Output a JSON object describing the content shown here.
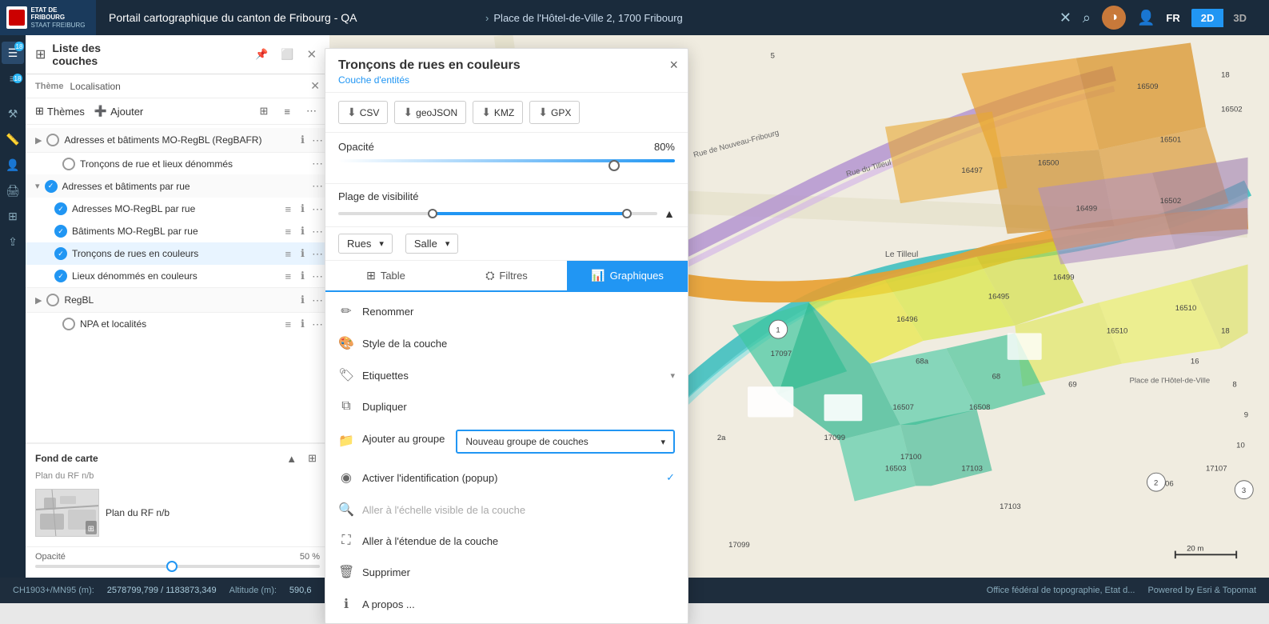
{
  "app": {
    "logo_line1": "ETAT DE FRIBOURG",
    "logo_line2": "STAAT FREIBURG",
    "title": "Portail cartographique du canton de Fribourg - QA",
    "location": "Place de l'Hôtel-de-Ville 2, 1700 Fribourg",
    "lang": "FR"
  },
  "view_toggle": {
    "btn_2d": "2D",
    "btn_3d": "3D"
  },
  "layer_panel": {
    "title": "Liste des couches",
    "theme_label": "Thème",
    "theme_name": "Localisation",
    "themes_btn": "Thèmes",
    "add_btn": "Ajouter",
    "layers": [
      {
        "name": "Adresses et bâtiments MO-RegBL (RegBAFR)",
        "type": "group",
        "indent": 0
      },
      {
        "name": "Tronçons de rue et lieux dénommés",
        "type": "layer",
        "indent": 0
      },
      {
        "name": "Adresses et bâtiments par rue",
        "type": "group_open",
        "indent": 0
      },
      {
        "name": "Adresses MO-RegBL par rue",
        "type": "layer",
        "indent": 1
      },
      {
        "name": "Bâtiments MO-RegBL par rue",
        "type": "layer",
        "indent": 1
      },
      {
        "name": "Tronçons de rues en couleurs",
        "type": "layer",
        "indent": 1
      },
      {
        "name": "Lieux dénommés en couleurs",
        "type": "layer",
        "indent": 1
      },
      {
        "name": "RegBL",
        "type": "group",
        "indent": 0
      },
      {
        "name": "NPA et localités",
        "type": "layer",
        "indent": 0
      }
    ],
    "fond_carte": {
      "label": "Fond de carte",
      "sub": "Plan du RF n/b",
      "map_name": "Plan du RF n/b"
    },
    "opacity": {
      "label": "Opacité",
      "value": "50 %"
    }
  },
  "popup": {
    "title": "Tronçons de rues en couleurs",
    "subtitle": "Couche d'entités",
    "close_label": "×",
    "export_buttons": [
      {
        "label": "CSV",
        "icon": "⬇"
      },
      {
        "label": "geoJSON",
        "icon": "⬇"
      },
      {
        "label": "KMZ",
        "icon": "⬇"
      },
      {
        "label": "GPX",
        "icon": "⬇"
      }
    ],
    "opacity_label": "Opacité",
    "opacity_value": "80%",
    "visibility_label": "Plage de visibilité",
    "dropdowns": [
      "Rues",
      "Salle"
    ],
    "tabs": [
      "Table",
      "Filtres",
      "Graphiques"
    ],
    "menu_items": [
      {
        "label": "Renommer",
        "icon": "✏",
        "disabled": false
      },
      {
        "label": "Style de la couche",
        "icon": "🎨",
        "disabled": false
      },
      {
        "label": "Etiquettes",
        "icon": "🏷",
        "disabled": false,
        "expandable": true
      },
      {
        "label": "Dupliquer",
        "icon": "⧉",
        "disabled": false
      },
      {
        "label": "Ajouter au groupe",
        "icon": "📁",
        "disabled": false,
        "has_dropdown": true
      },
      {
        "label": "Activer l'identification (popup)",
        "icon": "◉",
        "disabled": false,
        "checked": true
      },
      {
        "label": "Aller à l'échelle visible de la couche",
        "icon": "🔍",
        "disabled": true
      },
      {
        "label": "Aller à l'étendue de la couche",
        "icon": "⛶",
        "disabled": false
      },
      {
        "label": "Supprimer",
        "icon": "🗑",
        "disabled": false
      },
      {
        "label": "A propos ...",
        "icon": "ℹ",
        "disabled": false
      }
    ],
    "group_dropdown_text": "Nouveau groupe de couches"
  },
  "status_bar": {
    "coord_label": "CH1903+/MN95 (m):",
    "coords": "2578799,799 / 1183873,349",
    "altitude_label": "Altitude (m):",
    "altitude": "590,6",
    "attribution": "Office fédéral de topographie, Etat d..."
  },
  "scale": {
    "label": "20 m"
  }
}
